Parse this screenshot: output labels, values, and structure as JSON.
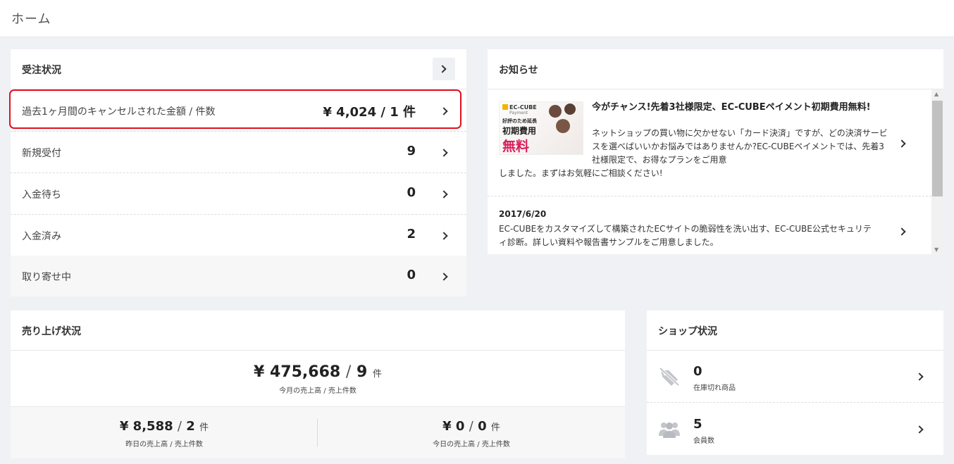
{
  "page": {
    "title": "ホーム"
  },
  "orders": {
    "title": "受注状況",
    "rows": [
      {
        "label": "過去1ヶ月間のキャンセルされた金額 / 件数",
        "value": "¥ 4,024 / 1 件"
      },
      {
        "label": "新規受付",
        "value": "9"
      },
      {
        "label": "入金待ち",
        "value": "0"
      },
      {
        "label": "入金済み",
        "value": "2"
      },
      {
        "label": "取り寄せ中",
        "value": "0"
      }
    ]
  },
  "news": {
    "title": "お知らせ",
    "thumb": {
      "logo": "EC-CUBE",
      "logo_sub": "Payment",
      "line1": "好評のため延長",
      "line2": "初期費用",
      "line3": "無料"
    },
    "items": [
      {
        "title": "今がチャンス!先着3社様限定、EC-CUBEペイメント初期費用無料!",
        "body": "ネットショップの買い物に欠かせない「カード決済」ですが、どの決済サービスを選べばいいかお悩みではありませんか?EC-CUBEペイメントでは、先着3社様限定で、お得なプランをご用意",
        "body_cont": "しました。まずはお気軽にご相談ください!"
      },
      {
        "date": "2017/6/20",
        "body": "EC-CUBEをカスタマイズして構築されたECサイトの脆弱性を洗い出す、EC-CUBE公式セキュリティ診断。詳しい資料や報告書サンプルをご用意しました。"
      }
    ]
  },
  "sales": {
    "title": "売り上げ状況",
    "month": {
      "amount": "¥ 475,668",
      "slash": "/",
      "count": "9",
      "unit": "件",
      "caption": "今月の売上高 / 売上件数"
    },
    "yesterday": {
      "amount": "¥ 8,588",
      "slash": "/",
      "count": "2",
      "unit": "件",
      "caption": "昨日の売上高 / 売上件数"
    },
    "today": {
      "amount": "¥ 0",
      "slash": "/",
      "count": "0",
      "unit": "件",
      "caption": "今日の売上高 / 売上件数"
    }
  },
  "shop": {
    "title": "ショップ状況",
    "rows": [
      {
        "value": "0",
        "caption": "在庫切れ商品",
        "icon": "tag-slash-icon"
      },
      {
        "value": "5",
        "caption": "会員数",
        "icon": "users-icon"
      }
    ]
  },
  "colors": {
    "highlight": "#e0101e",
    "background": "#f0f1f5",
    "accent_pink": "#d81d5a"
  }
}
